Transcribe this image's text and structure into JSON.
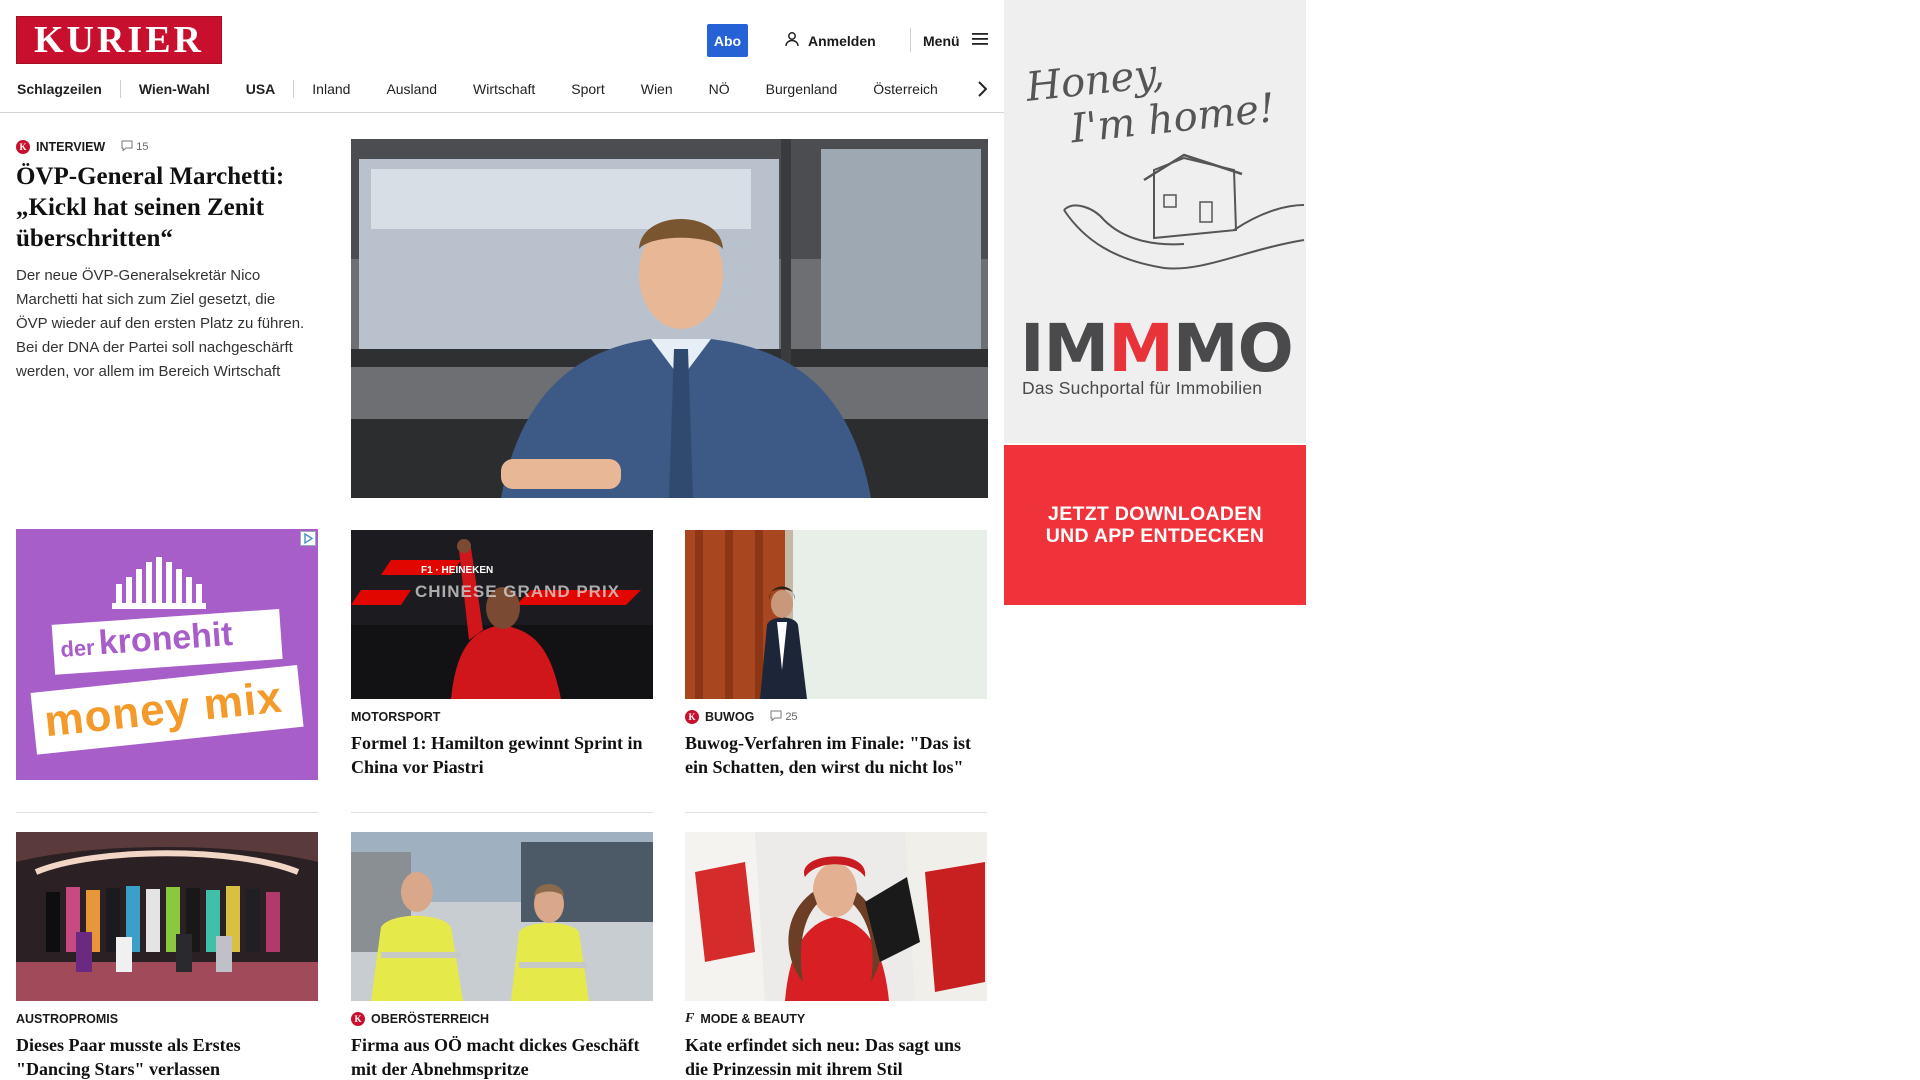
{
  "header": {
    "logo": "KURIER",
    "abo_label": "Abo",
    "login_label": "Anmelden",
    "menu_label": "Menü"
  },
  "nav": {
    "items": [
      "Schlagzeilen",
      "Wien-Wahl",
      "USA",
      "Inland",
      "Ausland",
      "Wirtschaft",
      "Sport",
      "Wien",
      "NÖ",
      "Burgenland",
      "Österreich"
    ]
  },
  "lead": {
    "kicker": "INTERVIEW",
    "comments": "15",
    "headline": "ÖVP-General Marchetti: „Kickl hat seinen Zenit überschritten“",
    "teaser": "Der neue ÖVP-Generalsekretär Nico Marchetti hat sich zum Ziel gesetzt, die ÖVP wieder auf den ersten Platz zu führen. Bei der DNA der Partei soll nachgeschärft werden, vor allem im Bereich Wirtschaft"
  },
  "ad_tile": {
    "line1_small": "der",
    "line1_big": "kronehit",
    "line2": "money mix"
  },
  "cards": [
    {
      "kicker": "MOTORSPORT",
      "title": "Formel 1: Hamilton gewinnt Sprint in China vor Piastri",
      "image_text_1": "F1 · HEINEKEN",
      "image_text_2": "CHINESE GRAND PRIX"
    },
    {
      "kicker": "BUWOG",
      "comments": "25",
      "title": "Buwog-Verfahren im Finale: \"Das ist ein Schatten, den wirst du nicht los\""
    },
    {
      "kicker": "AUSTROPROMIS",
      "title": "Dieses Paar musste als Erstes \"Dancing Stars\" verlassen"
    },
    {
      "kicker": "OBERÖSTERREICH",
      "title": "Firma aus OÖ macht dickes Geschäft mit der Abnehmspritze"
    },
    {
      "kicker": "MODE & BEAUTY",
      "title": "Kate erfindet sich neu: Das sagt uns die Prinzessin mit ihrem Stil"
    }
  ],
  "right_ad": {
    "tagline_1": "Honey,",
    "tagline_2": "I'm home!",
    "brand_a": "IM",
    "brand_b": "M",
    "brand_c": "MO",
    "subtitle": "Das Suchportal für Immobilien",
    "cta_1": "JETZT DOWNLOADEN",
    "cta_2": "UND APP ENTDECKEN"
  },
  "colors": {
    "brand_red": "#c8102e",
    "abo_blue": "#2462d6",
    "ad_purple": "#a85ec9",
    "immmo_red": "#f0333a"
  }
}
